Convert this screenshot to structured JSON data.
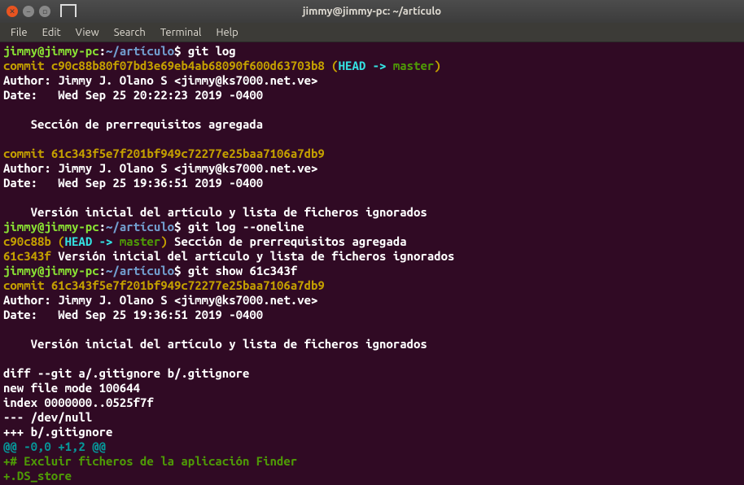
{
  "window": {
    "title": "jimmy@jimmy-pc: ~/artículo"
  },
  "menubar": {
    "items": [
      "File",
      "Edit",
      "View",
      "Search",
      "Terminal",
      "Help"
    ]
  },
  "prompt": {
    "user_host": "jimmy@jimmy-pc",
    "sep": ":",
    "cwd": "~/artículo",
    "dollar": "$ "
  },
  "cmds": {
    "git_log": "git log",
    "git_log_oneline": "git log --oneline",
    "git_show": "git show 61c343f"
  },
  "log1": {
    "commit_prefix": "commit ",
    "hash": "c90c88b80f07bd3e69eb4ab68090f600d63703b8",
    "head_open": " (",
    "head_label": "HEAD -> ",
    "branch": "master",
    "head_close": ")",
    "author": "Author: Jimmy J. Olano S <jimmy@ks7000.net.ve>",
    "date": "Date:   Wed Sep 25 20:22:23 2019 -0400",
    "msg": "    Sección de prerrequisitos agregada"
  },
  "log2": {
    "commit_prefix": "commit ",
    "hash": "61c343f5e7f201bf949c72277e25baa7106a7db9",
    "author": "Author: Jimmy J. Olano S <jimmy@ks7000.net.ve>",
    "date": "Date:   Wed Sep 25 19:36:51 2019 -0400",
    "msg": "    Versión inicial del artículo y lista de ficheros ignorados"
  },
  "oneline1": {
    "hash": "c90c88b",
    "open": " (",
    "head_label": "HEAD -> ",
    "branch": "master",
    "close": ")",
    "msg": " Sección de prerrequisitos agregada"
  },
  "oneline2": {
    "hash": "61c343f",
    "msg": " Versión inicial del artículo y lista de ficheros ignorados"
  },
  "show": {
    "commit_prefix": "commit ",
    "hash": "61c343f5e7f201bf949c72277e25baa7106a7db9",
    "author": "Author: Jimmy J. Olano S <jimmy@ks7000.net.ve>",
    "date": "Date:   Wed Sep 25 19:36:51 2019 -0400",
    "msg": "    Versión inicial del artículo y lista de ficheros ignorados",
    "diff_line": "diff --git a/.gitignore b/.gitignore",
    "newfile": "new file mode 100644",
    "index": "index 0000000..0525f7f",
    "minus": "--- /dev/null",
    "plus": "+++ b/.gitignore",
    "hunk": "@@ -0,0 +1,2 @@",
    "add1": "+# Excluir ficheros de la aplicación Finder",
    "add2": "+.DS_store"
  }
}
